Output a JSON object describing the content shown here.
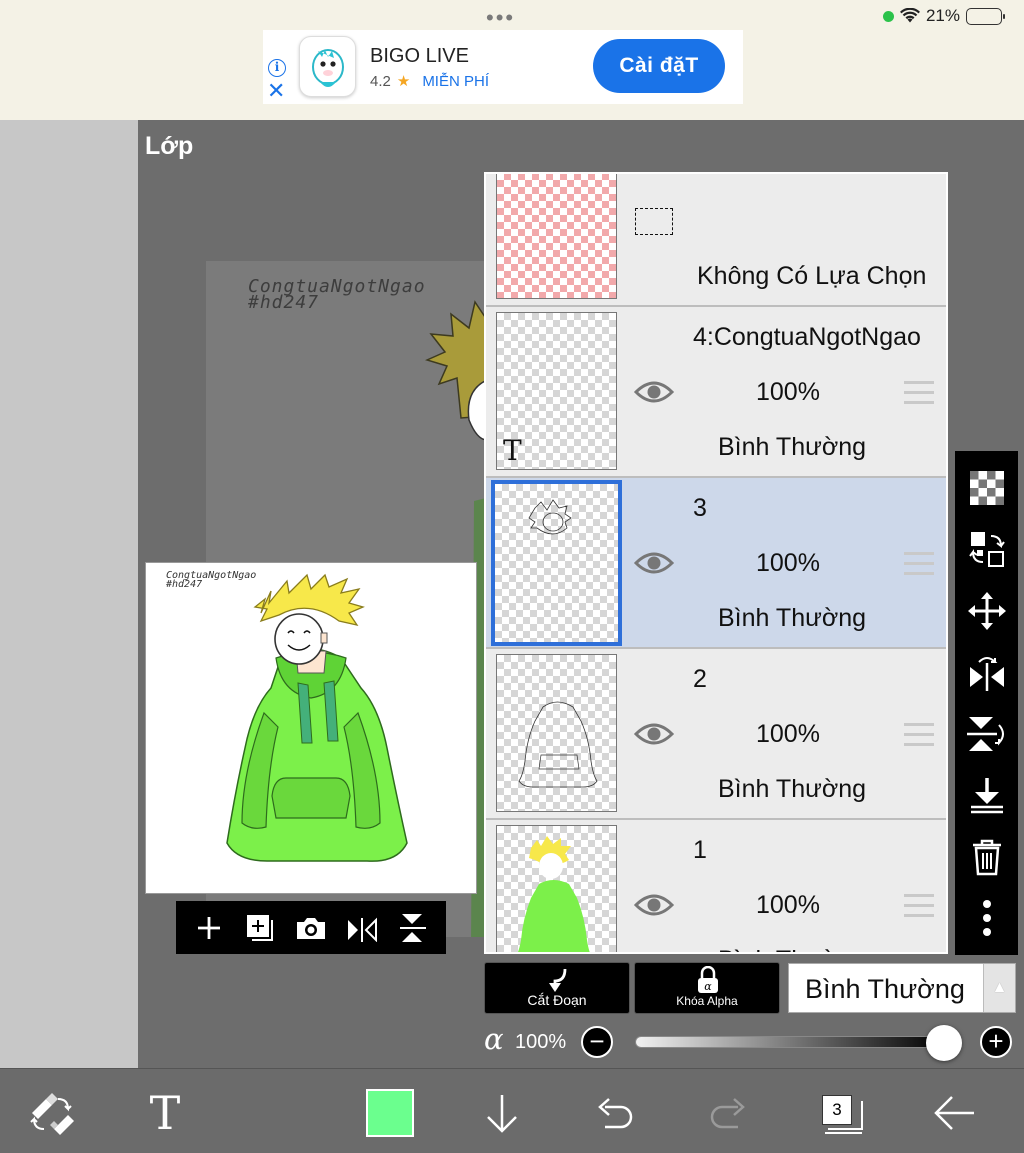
{
  "status_bar": {
    "battery_text": "21%",
    "battery_level": 0.21,
    "indicator_color": "#2bc24a"
  },
  "ad": {
    "app_name": "BIGO LIVE",
    "rating": "4.2",
    "price": "MIỄN PHÍ",
    "install_label": "Cài đặT",
    "accent_color": "#1a73e8"
  },
  "workspace": {
    "heading": "Lớp",
    "watermark_line1": "CongtuaNgotNgao",
    "watermark_line2": "#hd247"
  },
  "layers": [
    {
      "id": "selection",
      "name": "",
      "mode": "Không Có Lựa Chọn",
      "thumb": "pink"
    },
    {
      "id": "4",
      "name": "4:CongtuaNgotNgao",
      "opacity": "100%",
      "mode": "Bình Thường",
      "type_badge": "T"
    },
    {
      "id": "3",
      "name": "3",
      "opacity": "100%",
      "mode": "Bình Thường",
      "selected": true
    },
    {
      "id": "2",
      "name": "2",
      "opacity": "100%",
      "mode": "Bình Thường"
    },
    {
      "id": "1",
      "name": "1",
      "opacity": "100%",
      "mode": "Bình Thường"
    }
  ],
  "controls": {
    "clip_label": "Cắt Đoạn",
    "alpha_lock_label": "Khóa Alpha",
    "alpha_lock_symbol": "α",
    "blend_mode": "Bình Thường",
    "alpha_symbol": "α",
    "alpha_value": "100%",
    "alpha_level": 1.0,
    "minus": "−",
    "plus": "+"
  },
  "bottom_bar": {
    "color": "#6bff8e",
    "layer_count": "3"
  },
  "colors": {
    "selected_row": "#cdd8ea",
    "selected_border": "#2e6fd9",
    "hoodie_green": "#7cf04a",
    "hair_yellow": "#f7e84a"
  }
}
